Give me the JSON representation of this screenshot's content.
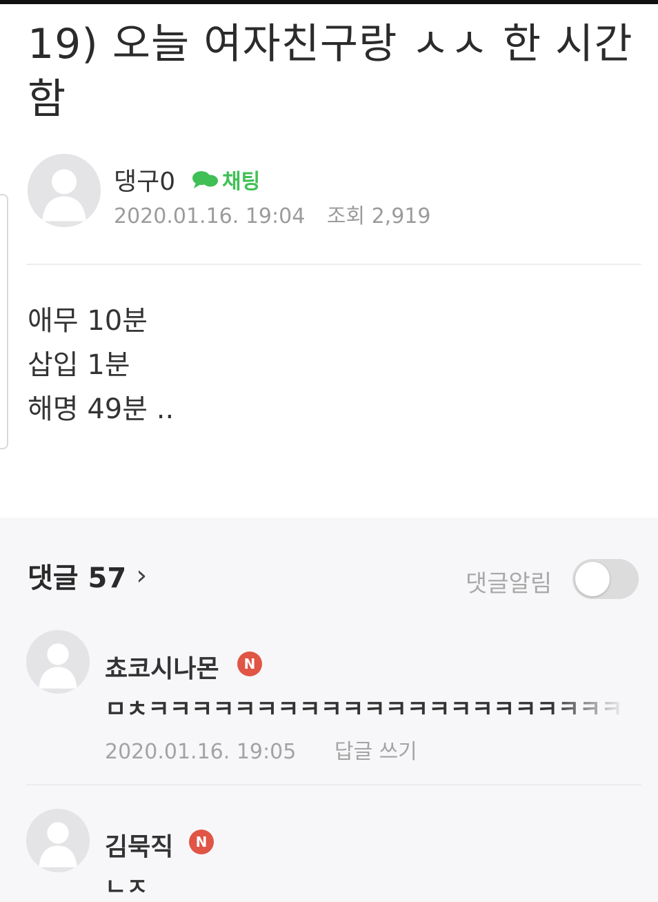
{
  "post": {
    "title": "19) 오늘 여자친구랑 ㅅㅅ 한 시간 함",
    "author": {
      "name": "댕구0",
      "chat_label": "채팅"
    },
    "date": "2020.01.16. 19:04",
    "views_label": "조회 2,919",
    "body_lines": [
      "애무 10분",
      "삽입 1분",
      "해명 49분 .."
    ]
  },
  "comments_section": {
    "header": "댓글 57",
    "notify_label": "댓글알림",
    "notify_on": false,
    "items": [
      {
        "author": "쵸코시나몬",
        "badge": "N",
        "text": "ㅁㅊㅋㅋㅋㅋㅋㅋㅋㅋㅋㅋㅋㅋㅋㅋㅋㅋㅋㅋㅋㅋㅋㅋㅋㅋ",
        "date": "2020.01.16. 19:05",
        "reply_label": "답글 쓰기"
      },
      {
        "author": "김묵직",
        "badge": "N",
        "text": "ㄴㅈ"
      }
    ]
  },
  "colors": {
    "chat_green": "#3fbf55",
    "badge_red": "#e05545",
    "toggle_off": "#dcdcdc"
  },
  "icons": [
    "avatar-placeholder-icon",
    "chat-bubble-icon",
    "chevron-right-icon",
    "naver-badge-icon"
  ]
}
